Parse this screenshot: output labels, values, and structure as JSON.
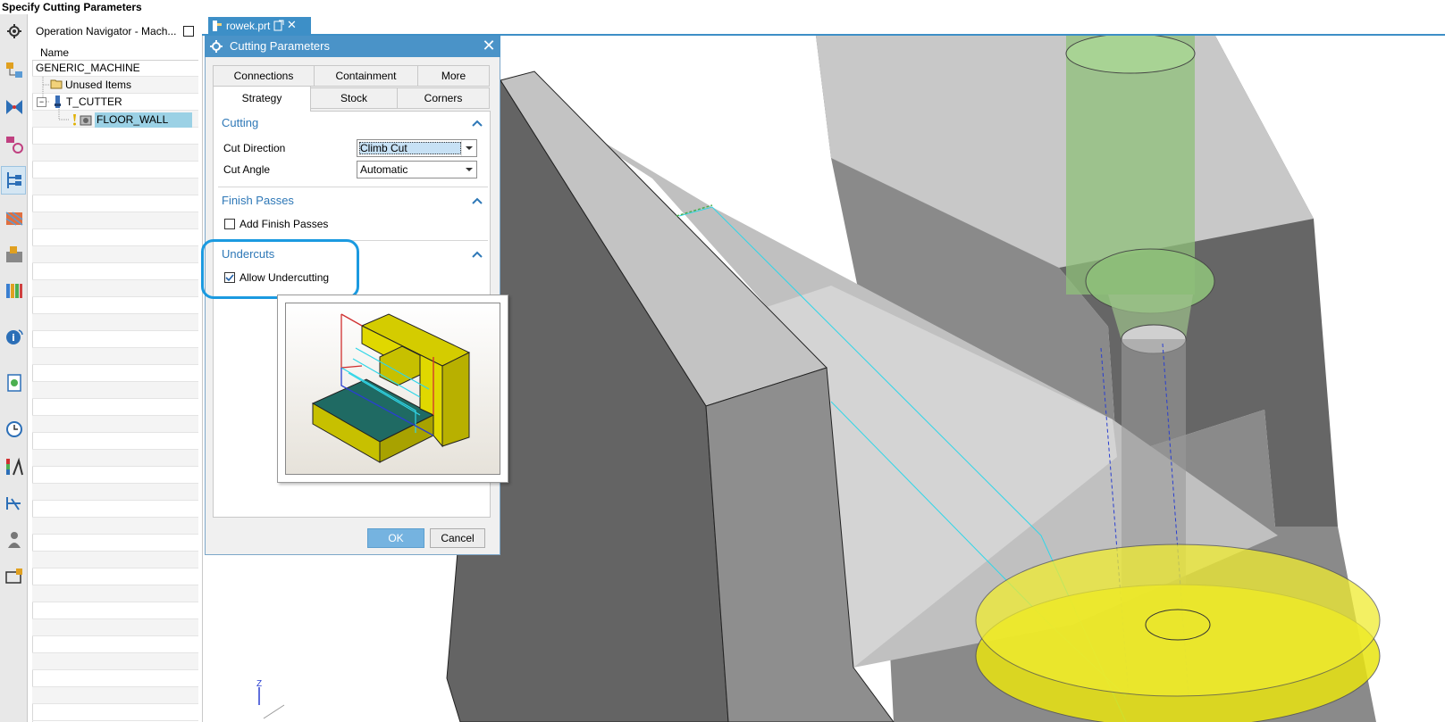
{
  "hint": {
    "text": "Specify Cutting Parameters"
  },
  "navigator": {
    "title": "Operation Navigator - Mach...",
    "column_name": "Name",
    "items": [
      {
        "label": "GENERIC_MACHINE"
      },
      {
        "label": "Unused Items"
      },
      {
        "label": "T_CUTTER"
      },
      {
        "label": "FLOOR_WALL"
      }
    ]
  },
  "file_tab": {
    "label": "rowek.prt"
  },
  "dialog": {
    "title": "Cutting Parameters",
    "tabs_row1": [
      "Connections",
      "Containment",
      "More"
    ],
    "tabs_row2": [
      "Strategy",
      "Stock",
      "Corners"
    ],
    "cutting": {
      "title": "Cutting",
      "cut_direction_label": "Cut Direction",
      "cut_direction_value": "Climb Cut",
      "cut_angle_label": "Cut Angle",
      "cut_angle_value": "Automatic"
    },
    "finish": {
      "title": "Finish Passes",
      "add_label": "Add Finish Passes",
      "add_checked": false
    },
    "undercuts": {
      "title": "Undercuts",
      "allow_label": "Allow Undercutting",
      "allow_checked": true
    },
    "ok_label": "OK",
    "cancel_label": "Cancel"
  },
  "triad": {
    "z_label": "Z"
  },
  "colors": {
    "accent": "#4a93c8",
    "highlight": "#1b9ae0",
    "part_dark": "#646464",
    "part_light": "#bfbfbf",
    "tool_green": "#8fc07a",
    "tool_yellow": "#e8e410"
  }
}
